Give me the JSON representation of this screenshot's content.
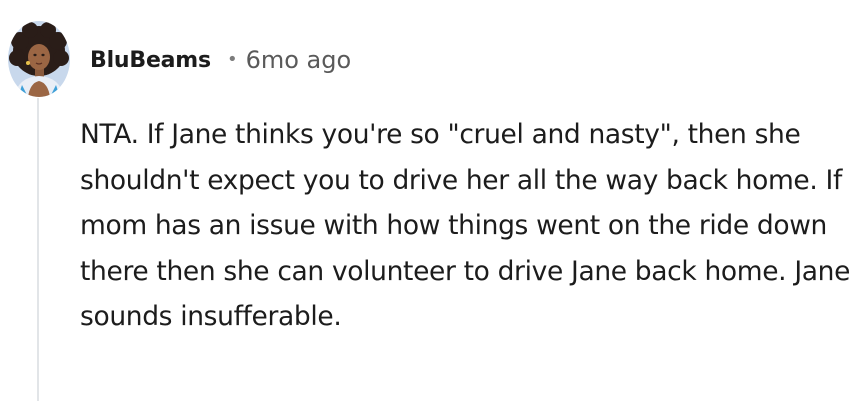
{
  "comment": {
    "author": "BluBeams",
    "separator": "•",
    "timestamp": "6mo ago",
    "avatar_icon": "user-avatar-icon",
    "text": "NTA. If Jane thinks you're so \"cruel and nasty\", then she shouldn't expect you to drive her all the way back home. If mom has an issue with how things went on the ride down there then she can volunteer to drive Jane back home. Jane sounds insufferable."
  },
  "colors": {
    "avatar_bg": "#c8d8ec",
    "thread_line": "#e2e5e8",
    "text": "#1c1c1c",
    "meta_text": "#5a5a5a"
  }
}
